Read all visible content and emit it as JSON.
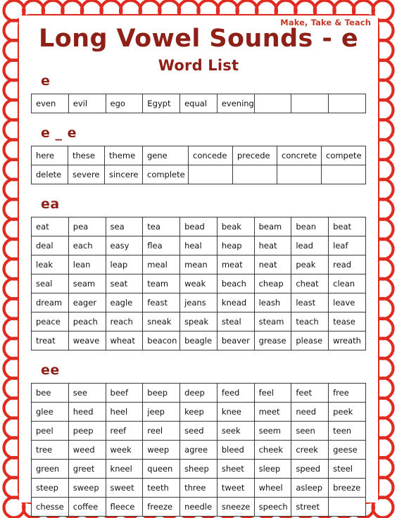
{
  "brand": "Make, Take & Teach",
  "title": "Long Vowel Sounds -  e",
  "subtitle": "Word List",
  "colors": {
    "frame_red": "#E02B21",
    "heading_red": "#8E2018",
    "brand_red": "#C0392B",
    "cell_border": "#3a3a3a",
    "page_background": "#ffffff"
  },
  "sections": [
    {
      "label": "e",
      "columns": 9,
      "rows": [
        [
          "even",
          "evil",
          "ego",
          "Egypt",
          "equal",
          "evening",
          "",
          "",
          ""
        ]
      ]
    },
    {
      "label": "e _ e",
      "columns": 8,
      "rows": [
        [
          "here",
          "these",
          "theme",
          "gene",
          "concede",
          "precede",
          "concrete",
          "compete"
        ],
        [
          "delete",
          "severe",
          "sincere",
          "complete",
          "",
          "",
          "",
          ""
        ]
      ]
    },
    {
      "label": "ea",
      "columns": 9,
      "rows": [
        [
          "eat",
          "pea",
          "sea",
          "tea",
          "bead",
          "beak",
          "beam",
          "bean",
          "beat"
        ],
        [
          "deal",
          "each",
          "easy",
          "flea",
          "heal",
          "heap",
          "heat",
          "lead",
          "leaf"
        ],
        [
          "leak",
          "lean",
          "leap",
          "meal",
          "mean",
          "meat",
          "neat",
          "peak",
          "read"
        ],
        [
          "seal",
          "seam",
          "seat",
          "team",
          "weak",
          "beach",
          "cheap",
          "cheat",
          "clean"
        ],
        [
          "dream",
          "eager",
          "eagle",
          "feast",
          "jeans",
          "knead",
          "leash",
          "least",
          "leave"
        ],
        [
          "peace",
          "peach",
          "reach",
          "sneak",
          "speak",
          "steal",
          "steam",
          "teach",
          "tease"
        ],
        [
          "treat",
          "weave",
          "wheat",
          "beacon",
          "beagle",
          "beaver",
          "grease",
          "please",
          "wreath"
        ]
      ]
    },
    {
      "label": "ee",
      "columns": 9,
      "rows": [
        [
          "bee",
          "see",
          "beef",
          "beep",
          "deep",
          "feed",
          "feel",
          "feet",
          "free"
        ],
        [
          "glee",
          "heed",
          "heel",
          "jeep",
          "keep",
          "knee",
          "meet",
          "need",
          "peek"
        ],
        [
          "peel",
          "peep",
          "reef",
          "reel",
          "seed",
          "seek",
          "seem",
          "seen",
          "teen"
        ],
        [
          "tree",
          "weed",
          "week",
          "weep",
          "agree",
          "bleed",
          "cheek",
          "creek",
          "geese"
        ],
        [
          "green",
          "greet",
          "kneel",
          "queen",
          "sheep",
          "sheet",
          "sleep",
          "speed",
          "steel"
        ],
        [
          "steep",
          "sweep",
          "sweet",
          "teeth",
          "three",
          "tweet",
          "wheel",
          "asleep",
          "breeze"
        ],
        [
          "chesse",
          "coffee",
          "fleece",
          "freeze",
          "needle",
          "sneeze",
          "speech",
          "street",
          ""
        ]
      ]
    }
  ]
}
